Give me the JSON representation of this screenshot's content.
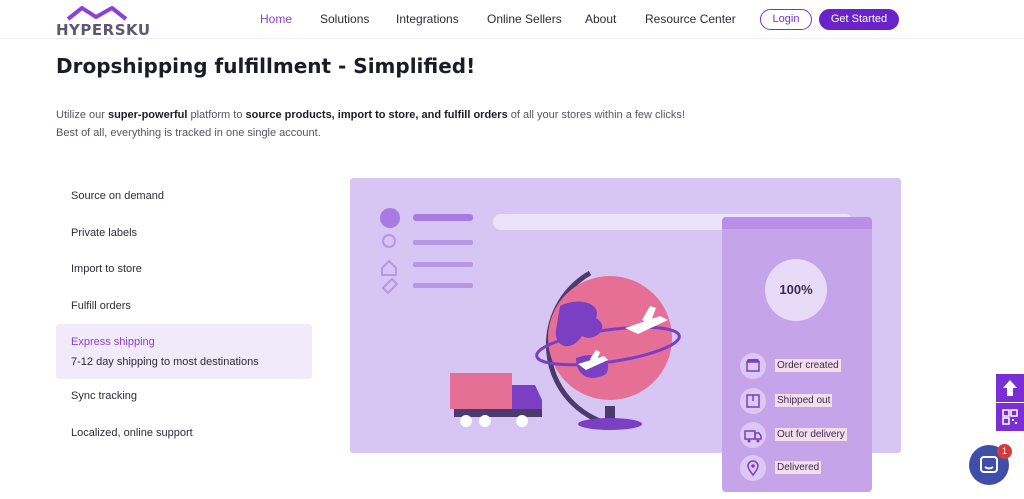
{
  "brand": {
    "name": "HYPERSKU",
    "accent": "#6a22c9",
    "nav_active": "#8e3fd6"
  },
  "nav": {
    "items": [
      {
        "label": "Home",
        "active": true
      },
      {
        "label": "Solutions",
        "active": false
      },
      {
        "label": "Integrations",
        "active": false
      },
      {
        "label": "Online Sellers",
        "active": false
      },
      {
        "label": "About",
        "active": false
      },
      {
        "label": "Resource Center",
        "active": false
      }
    ],
    "login_label": "Login",
    "cta_label": "Get Started"
  },
  "hero": {
    "title": "Dropshipping fulfillment - Simplified!",
    "intro": {
      "t1": "Utilize our ",
      "b1": "super-powerful",
      "t2": " platform to ",
      "b2": "source products, import to store, and fulfill orders",
      "t3": " of all your stores within a few clicks! Best of all, everything is tracked in one single account."
    }
  },
  "features": [
    {
      "title": "Source on demand"
    },
    {
      "title": "Private labels"
    },
    {
      "title": "Import to store"
    },
    {
      "title": "Fulfill orders"
    },
    {
      "title": "Express shipping",
      "subtitle": "7-12 day shipping to most destinations",
      "active": true
    },
    {
      "title": "Sync tracking"
    },
    {
      "title": "Localized, online support"
    }
  ],
  "tracking_card": {
    "progress_label": "100%",
    "steps": [
      {
        "label": "Order created",
        "icon": "store-icon"
      },
      {
        "label": "Shipped out",
        "icon": "package-icon"
      },
      {
        "label": "Out for delivery",
        "icon": "truck-icon"
      },
      {
        "label": "Delivered",
        "icon": "location-pin-icon"
      }
    ]
  },
  "floating": {
    "scroll_top_icon": "arrow-up-icon",
    "qr_icon": "qr-code-icon",
    "chat_icon": "chat-icon",
    "chat_badge": "1"
  }
}
